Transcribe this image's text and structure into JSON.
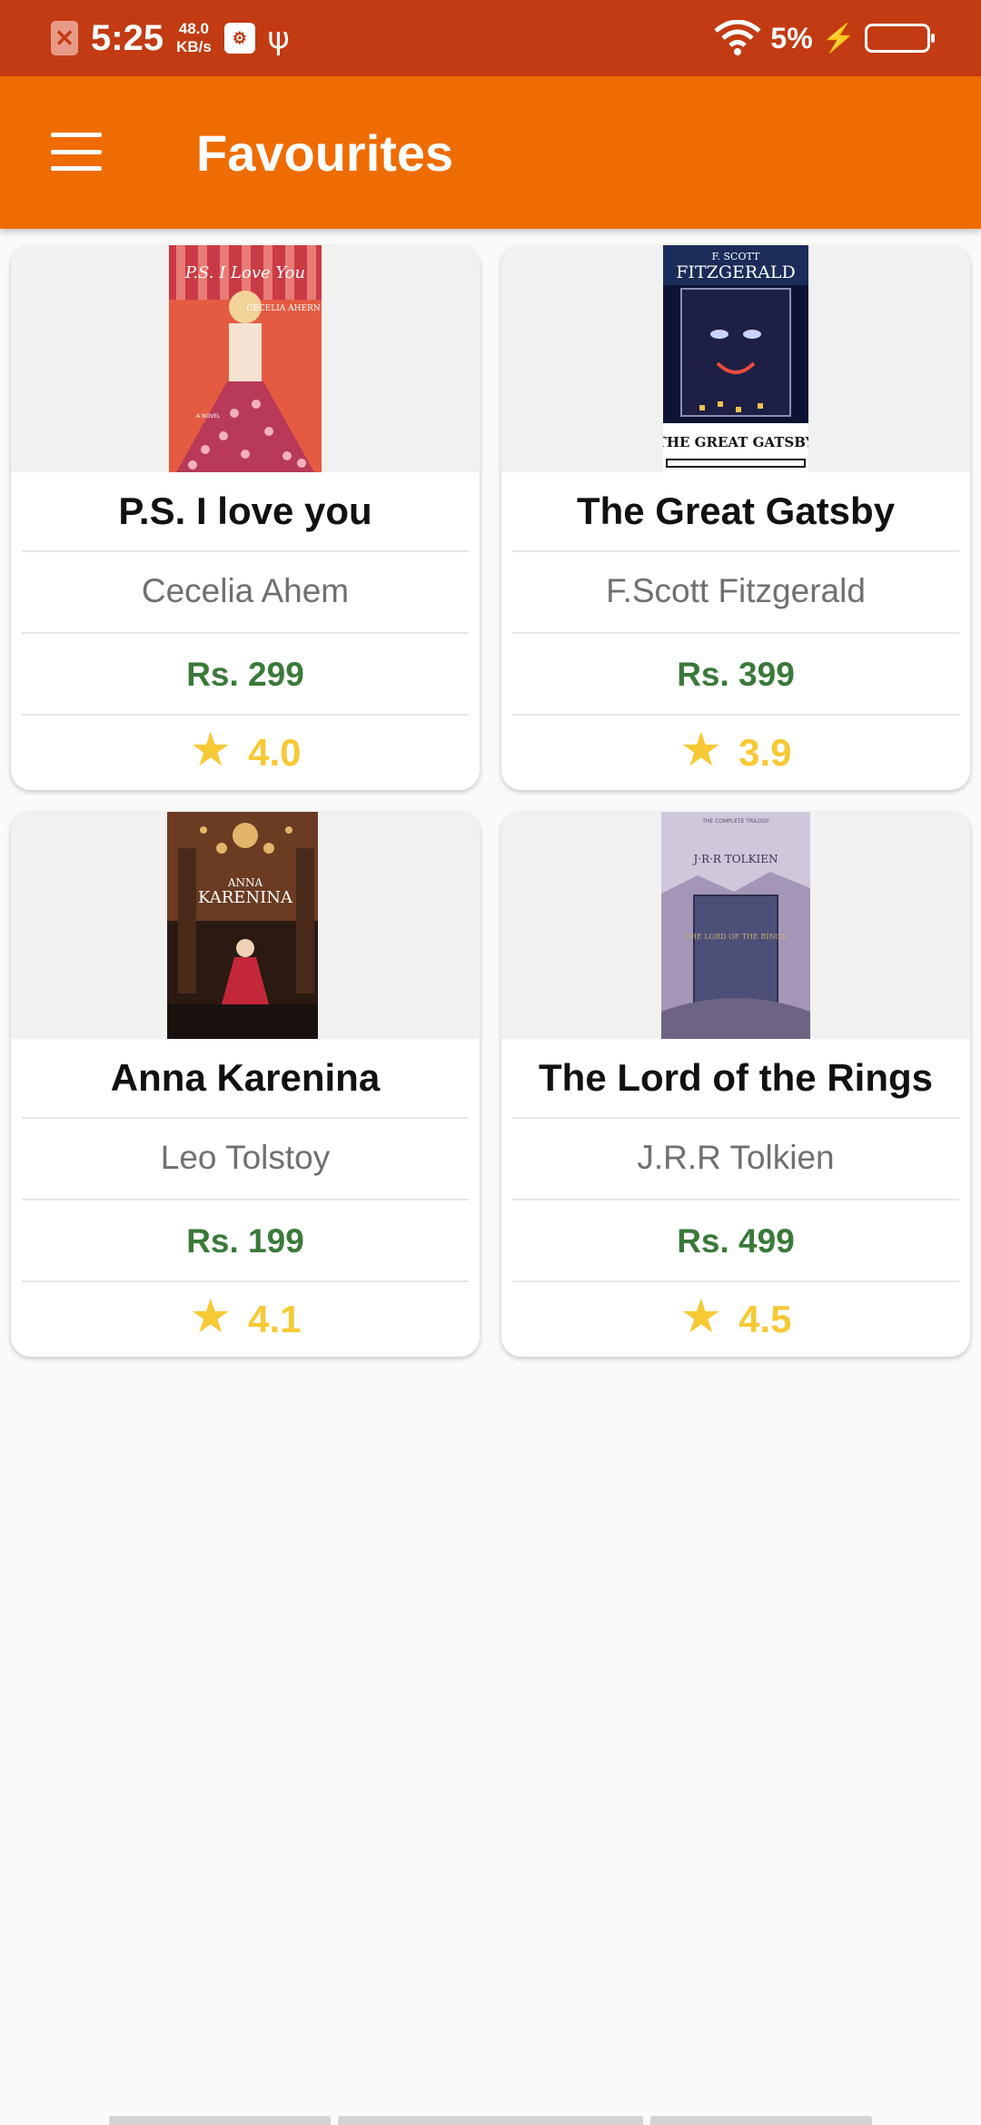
{
  "status_bar": {
    "time": "5:25",
    "speed_value": "48.0",
    "speed_unit": "KB/s",
    "battery": "5%",
    "icons": [
      "notification-x-icon",
      "usb-debug-icon",
      "usb-icon",
      "wifi-icon",
      "charging-bolt-icon",
      "battery-icon"
    ]
  },
  "app_bar": {
    "title": "Favourites",
    "menu_icon": "hamburger-menu-icon",
    "background": "#ef6c02"
  },
  "books": [
    {
      "title": "P.S. I love you",
      "author": "Cecelia Ahem",
      "price": "Rs. 299",
      "rating": "4.0",
      "cover": {
        "line1": "P.S. I Love You",
        "line2": "CECELIA AHERN",
        "line3": "A NOVEL",
        "colors": [
          "#e55b42",
          "#c93a45"
        ]
      }
    },
    {
      "title": "The Great Gatsby",
      "author": "F.Scott Fitzgerald",
      "price": "Rs. 399",
      "rating": "3.9",
      "cover": {
        "line1": "F. SCOTT",
        "line2": "FITZGERALD",
        "line3": "THE GREAT GATSBY",
        "colors": [
          "#1b2c5a",
          "#0b1432"
        ]
      }
    },
    {
      "title": "Anna Karenina",
      "author": "Leo Tolstoy",
      "price": "Rs. 199",
      "rating": "4.1",
      "cover": {
        "line1": "ANNA",
        "line2": "KARENINA",
        "line3": "",
        "colors": [
          "#6b3b22",
          "#2a1a12"
        ]
      }
    },
    {
      "title": "The Lord of the Rings",
      "author": "J.R.R Tolkien",
      "price": "Rs. 499",
      "rating": "4.5",
      "cover": {
        "line1": "J·R·R TOLKIEN",
        "line2": "THE LORD OF THE RINGS",
        "line3": "",
        "colors": [
          "#b2a7c0",
          "#6d6383"
        ]
      }
    }
  ],
  "colors": {
    "status_bar": "#c23b12",
    "price": "#3a7a39",
    "rating": "#f7c935"
  }
}
